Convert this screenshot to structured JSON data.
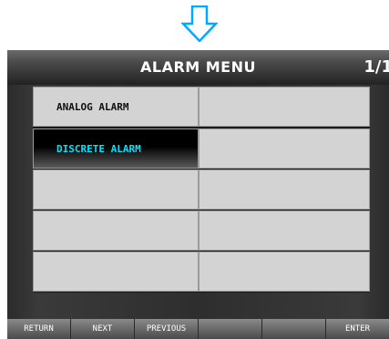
{
  "indicator": {
    "icon": "down-arrow-icon",
    "color": "#00aaff"
  },
  "screen": {
    "title": "ALARM MENU",
    "page": "1/1"
  },
  "menu": {
    "items": [
      {
        "label": "ANALOG ALARM",
        "selected": false
      },
      {
        "label": "",
        "selected": false
      },
      {
        "label": "DISCRETE ALARM",
        "selected": true
      },
      {
        "label": "",
        "selected": false
      },
      {
        "label": "",
        "selected": false
      },
      {
        "label": "",
        "selected": false
      },
      {
        "label": "",
        "selected": false
      },
      {
        "label": "",
        "selected": false
      },
      {
        "label": "",
        "selected": false
      },
      {
        "label": "",
        "selected": false
      }
    ],
    "selected_color": "#00e5ff"
  },
  "function_keys": [
    {
      "label": "RETURN"
    },
    {
      "label": "NEXT"
    },
    {
      "label": "PREVIOUS"
    },
    {
      "label": ""
    },
    {
      "label": ""
    },
    {
      "label": "ENTER"
    }
  ]
}
